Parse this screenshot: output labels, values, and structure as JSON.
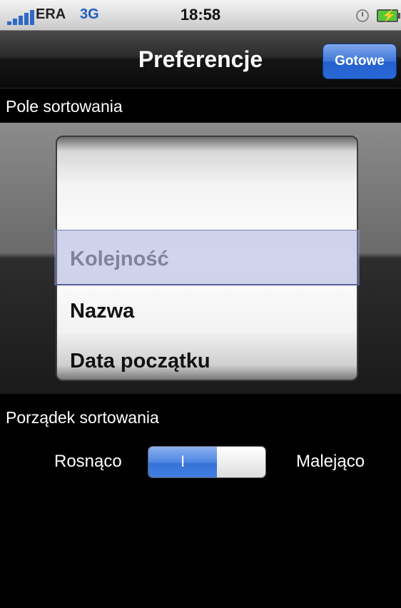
{
  "status_bar": {
    "carrier": "ERA",
    "network": "3G",
    "time": "18:58",
    "icons": [
      "signal-icon",
      "alarm-icon",
      "battery-charging-icon"
    ]
  },
  "nav": {
    "title": "Preferencje",
    "done_label": "Gotowe"
  },
  "sort_field": {
    "label": "Pole sortowania",
    "options": [
      "Kolejność",
      "Nazwa",
      "Data początku"
    ],
    "selected": "Kolejność"
  },
  "sort_order": {
    "label": "Porządek sortowania",
    "left_label": "Rosnąco",
    "right_label": "Malejąco",
    "toggle_on_text": "I",
    "state": "on"
  },
  "colors": {
    "accent": "#2a68d6",
    "background": "#000000"
  }
}
